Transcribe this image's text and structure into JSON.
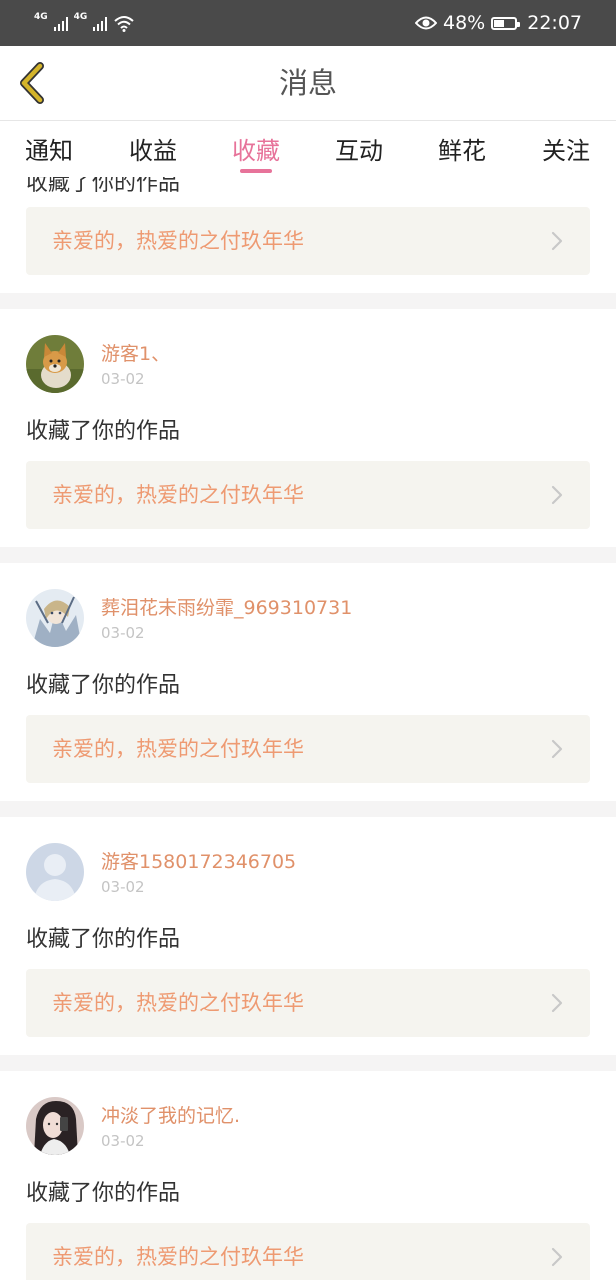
{
  "status_bar": {
    "network_1": "4G",
    "network_2": "4G",
    "battery": "48%",
    "battery_level": 0.48,
    "time": "22:07",
    "icons": [
      "signal-icon",
      "signal-icon",
      "wifi-icon",
      "eye-icon",
      "battery-icon"
    ]
  },
  "header": {
    "title": "消息",
    "back_icon": "chevron-left-icon"
  },
  "tabs": [
    {
      "label": "通知"
    },
    {
      "label": "收益"
    },
    {
      "label": "收藏",
      "active": true
    },
    {
      "label": "互动"
    },
    {
      "label": "鲜花"
    },
    {
      "label": "关注"
    }
  ],
  "colors": {
    "accent": "#e7739a",
    "username": "#e0916a",
    "work_title": "#ee9a72",
    "work_bg": "#f5f4ef",
    "status_bar": "#4a4a4a",
    "back_arrow": "#d4b42a"
  },
  "feed": {
    "partial": {
      "action": "收藏了你的作品",
      "work_title": "亲爱的，热爱的之付玖年华"
    },
    "items": [
      {
        "username": "游客1、",
        "date": "03-02",
        "action": "收藏了你的作品",
        "work_title": "亲爱的，热爱的之付玖年华",
        "avatar": "dog-photo-avatar"
      },
      {
        "username": "葬泪花末雨纷霏_969310731",
        "date": "03-02",
        "action": "收藏了你的作品",
        "work_title": "亲爱的，热爱的之付玖年华",
        "avatar": "anime-avatar"
      },
      {
        "username": "游客1580172346705",
        "date": "03-02",
        "action": "收藏了你的作品",
        "work_title": "亲爱的，热爱的之付玖年华",
        "avatar": "default-user-avatar"
      },
      {
        "username": "冲淡了我的记忆.",
        "date": "03-02",
        "action": "收藏了你的作品",
        "work_title": "亲爱的，热爱的之付玖年华",
        "avatar": "portrait-photo-avatar"
      }
    ]
  }
}
